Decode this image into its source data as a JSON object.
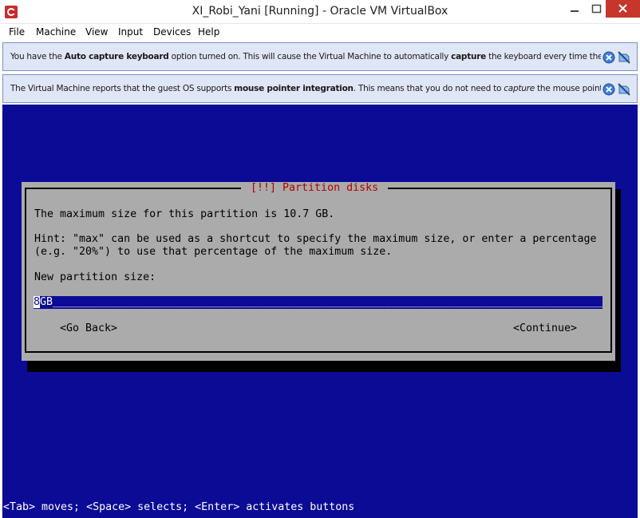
{
  "window": {
    "title": "XI_Robi_Yani [Running] - Oracle VM VirtualBox",
    "icon": "virtualbox-app-icon",
    "controls": [
      "minimize-icon",
      "maximize-icon",
      "close-icon"
    ]
  },
  "menubar": {
    "items": [
      "File",
      "Machine",
      "View",
      "Input",
      "Devices",
      "Help"
    ]
  },
  "notifications": [
    {
      "prefix": "You have the ",
      "bold1": "Auto capture keyboard",
      "middle": " option turned on. This will cause the Virtual Machine to automatically ",
      "bold2": "capture",
      "suffix": " the keyboard every time the VM"
    },
    {
      "prefix": "The Virtual Machine reports that the guest OS supports ",
      "bold1": "mouse pointer integration",
      "middle": ". This means that you do not need to ",
      "italic": "capture",
      "suffix": " the mouse pointer"
    }
  ],
  "dialog": {
    "title": "[!!] Partition disks",
    "line1": "The maximum size for this partition is 10.7 GB.",
    "line2": "Hint: \"max\" can be used as a shortcut to specify the maximum size, or enter a percentage",
    "line3": "(e.g. \"20%\") to use that percentage of the maximum size.",
    "line4": "New partition size:",
    "input_cursor_char": "8",
    "input_rest": "GB_______________________________________________________________________________________",
    "go_back": "<Go Back>",
    "continue": "<Continue>"
  },
  "status_line": "<Tab> moves; <Space> selects; <Enter> activates buttons",
  "colors": {
    "vm_background": "#0b0b96",
    "dialog_background": "#ababab",
    "dialog_title": "#b00000",
    "notice_background": "#dfe6f6",
    "close_button": "#c7362d"
  }
}
